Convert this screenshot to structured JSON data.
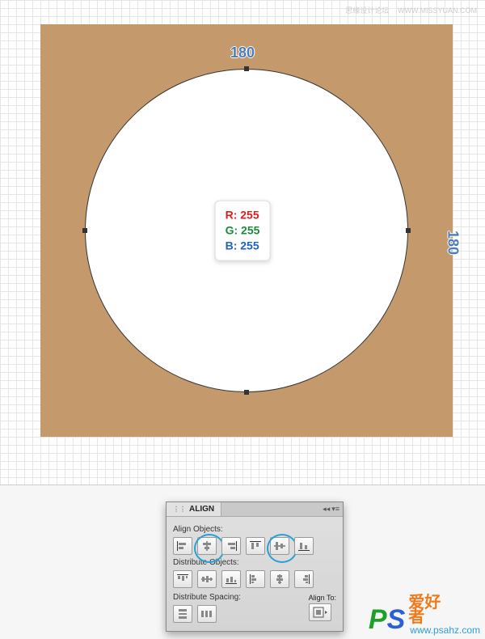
{
  "watermark_top": {
    "text": "思缘设计论坛",
    "url": "WWW.MISSYUAN.COM"
  },
  "canvas": {
    "dim_top": "180",
    "dim_right": "180",
    "rgb": {
      "r": "R: 255",
      "g": "G: 255",
      "b": "B: 255"
    }
  },
  "panel": {
    "title": "ALIGN",
    "sections": {
      "align_objects": "Align Objects:",
      "distribute_objects": "Distribute Objects:",
      "distribute_spacing": "Distribute Spacing:",
      "align_to": "Align To:"
    }
  },
  "watermark_bottom": {
    "ps_p": "P",
    "ps_s": "S",
    "cn1": "爱好",
    "cn2": "者",
    "url": "www.psahz.com"
  }
}
